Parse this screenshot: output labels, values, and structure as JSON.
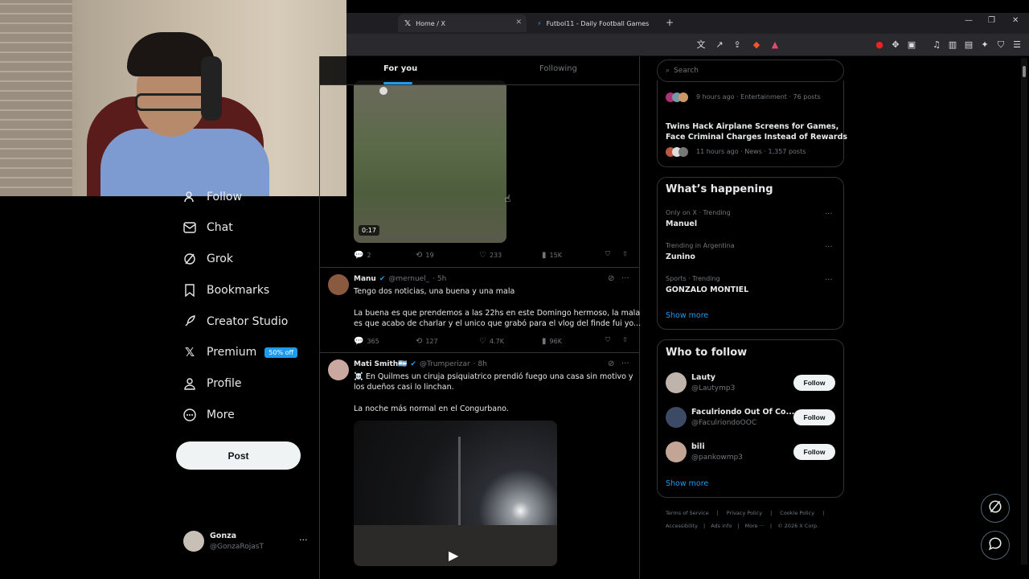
{
  "browser": {
    "tabs": [
      {
        "label": "Home / X",
        "icon": "x-logo-icon"
      },
      {
        "label": "Futbol11 - Daily Football Games",
        "icon": "futbol11-icon"
      }
    ],
    "new_tab": "+"
  },
  "nav": {
    "items": [
      {
        "label": "Follow",
        "icon": "person-plus-icon"
      },
      {
        "label": "Chat",
        "icon": "mail-icon"
      },
      {
        "label": "Grok",
        "icon": "grok-icon"
      },
      {
        "label": "Bookmarks",
        "icon": "bookmark-icon"
      },
      {
        "label": "Creator Studio",
        "icon": "rocket-icon"
      },
      {
        "label": "Premium",
        "icon": "x-logo-icon",
        "badge": "50% off"
      },
      {
        "label": "Profile",
        "icon": "person-icon"
      },
      {
        "label": "More",
        "icon": "more-circle-icon"
      }
    ],
    "post_label": "Post",
    "account": {
      "name": "Gonza",
      "handle": "@GonzaRojasT"
    }
  },
  "timeline": {
    "tabs": [
      "For you",
      "Following"
    ],
    "video1": {
      "duration": "0:17",
      "replies": "2",
      "reposts": "19",
      "likes": "233",
      "views": "15K"
    },
    "tweet1": {
      "name": "Manu",
      "handle": "@mernuel_",
      "time": "· 5h",
      "line1": "Tengo dos noticias, una buena y una mala",
      "line2": "La buena es que prendemos a las 22hs en este Domingo hermoso, la mala",
      "line3": "es que acabo de charlar y el unico que grabó para el vlog del finde fui yo...",
      "replies": "365",
      "reposts": "127",
      "likes": "4.7K",
      "views": "96K"
    },
    "tweet2": {
      "name": "Mati Smith🇦🇷",
      "handle": "@Trumperizar",
      "time": "· 8h",
      "line1": "☠️ En Quilmes un ciruja psiquiatrico prendió fuego una casa sin motivo y",
      "line2": "los dueños casi lo linchan.",
      "line3": "La noche más normal en el Congurbano."
    }
  },
  "sidebar": {
    "search_placeholder": "Search",
    "news": [
      {
        "meta": "9 hours ago · Entertainment · 76 posts"
      },
      {
        "title1": "Twins Hack Airplane Screens for Games,",
        "title2": "Face Criminal Charges Instead of Rewards",
        "meta": "11 hours ago · News · 1,357 posts"
      }
    ],
    "happening": {
      "title": "What’s happening",
      "items": [
        {
          "context": "Only on X · Trending",
          "topic": "Manuel"
        },
        {
          "context": "Trending in Argentina",
          "topic": "Zunino"
        },
        {
          "context": "Sports · Trending",
          "topic": "GONZALO MONTIEL"
        }
      ],
      "show_more": "Show more"
    },
    "who_to_follow": {
      "title": "Who to follow",
      "users": [
        {
          "name": "Lauty",
          "handle": "@Lautymp3"
        },
        {
          "name": "Faculriondo Out Of Co...",
          "handle": "@FaculriondoOOC"
        },
        {
          "name": "bili",
          "handle": "@pankowmp3"
        }
      ],
      "follow_label": "Follow",
      "show_more": "Show more"
    },
    "footer": {
      "line1": [
        "Terms of Service",
        "Privacy Policy",
        "Cookie Policy"
      ],
      "line2": [
        "Accessibility",
        "Ads info",
        "More ···",
        "© 2026 X Corp."
      ]
    }
  },
  "colors": {
    "accent": "#1d9bf0",
    "background": "#000000",
    "border": "#2f3336",
    "muted": "#71767b"
  }
}
